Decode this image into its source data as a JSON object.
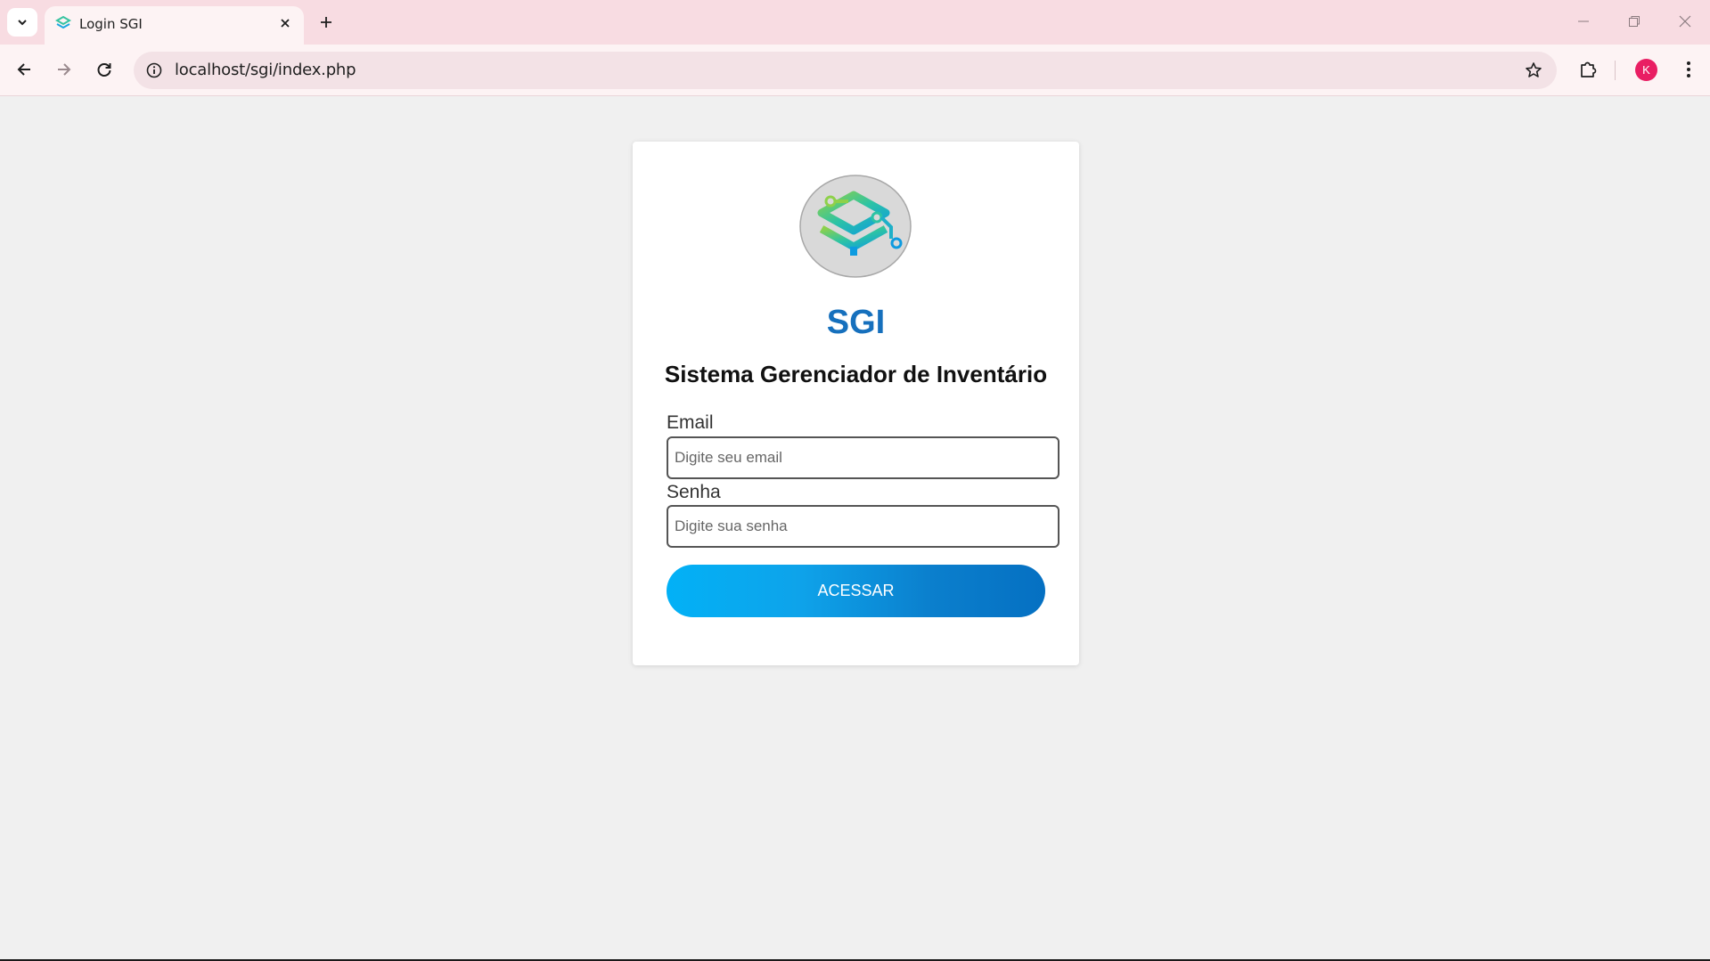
{
  "browser": {
    "tab_title": "Login SGI",
    "url": "localhost/sgi/index.php",
    "profile_initial": "K",
    "icons": {
      "tab_search": "chevron-down-icon",
      "close_tab": "close-icon",
      "new_tab": "plus-icon",
      "back": "arrow-left-icon",
      "forward": "arrow-right-icon",
      "reload": "reload-icon",
      "site_info": "info-icon",
      "bookmark": "star-icon",
      "extensions": "puzzle-icon",
      "menu": "kebab-menu-icon",
      "minimize": "minimize-icon",
      "restore": "restore-icon",
      "close_window": "close-icon"
    },
    "colors": {
      "tabstrip": "#f8dce2",
      "toolbar": "#fdf3f4",
      "avatar": "#e91e63"
    }
  },
  "login": {
    "brand": "SGI",
    "subtitle": "Sistema Gerenciador de Inventário",
    "email_label": "Email",
    "email_placeholder": "Digite seu email",
    "email_value": "",
    "password_label": "Senha",
    "password_placeholder": "Digite sua senha",
    "password_value": "",
    "submit_label": "ACESSAR",
    "colors": {
      "brand": "#1670bd",
      "button_start": "#02b1f6",
      "button_end": "#0570c2"
    }
  }
}
